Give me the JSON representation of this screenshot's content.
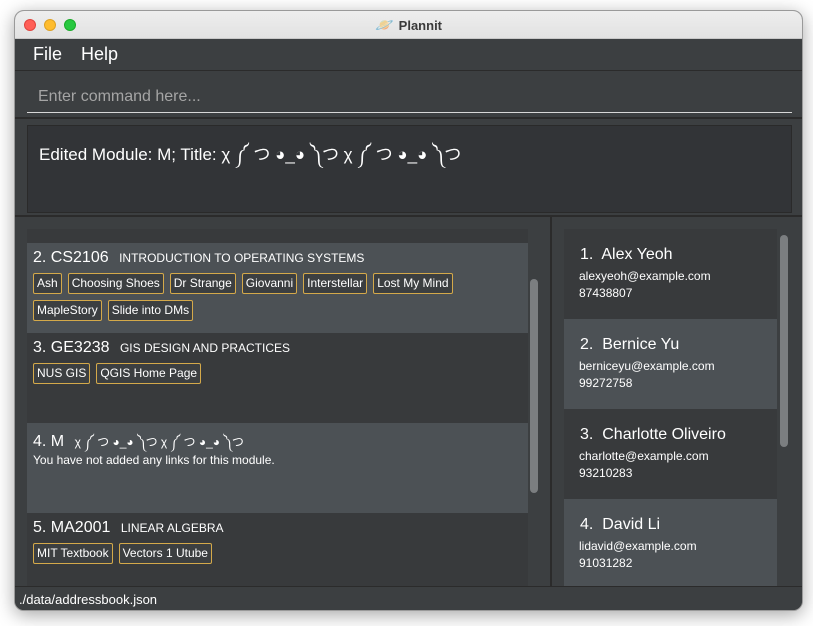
{
  "window": {
    "title": "Plannit",
    "app_icon": "planet-icon"
  },
  "menu": {
    "file_label": "File",
    "help_label": "Help"
  },
  "command": {
    "placeholder": "Enter command here...",
    "value": ""
  },
  "result": {
    "text": "Edited Module: M; Title: χ ༼ つ ◕_◕ ༽つ χ ༼ つ ◕_◕ ༽つ"
  },
  "modules": [
    {
      "number": "2.",
      "code": "CS2106",
      "title": "INTRODUCTION TO OPERATING SYSTEMS",
      "links": [
        "Ash",
        "Choosing Shoes",
        "Dr Strange",
        "Giovanni",
        "Interstellar",
        "Lost My Mind",
        "MapleStory",
        "Slide into DMs"
      ]
    },
    {
      "number": "3.",
      "code": "GE3238",
      "title": "GIS DESIGN AND PRACTICES",
      "links": [
        "NUS GIS",
        "QGIS Home Page"
      ]
    },
    {
      "number": "4.",
      "code": "M",
      "title": "χ ༼ つ ◕_◕ ༽つ χ ༼ つ ◕_◕ ༽つ",
      "empty_message": "You have not added any links for this module.",
      "links": []
    },
    {
      "number": "5.",
      "code": "MA2001",
      "title": "LINEAR ALGEBRA",
      "links": [
        "MIT Textbook",
        "Vectors 1 Utube"
      ]
    }
  ],
  "persons": [
    {
      "number": "1.",
      "name": "Alex Yeoh",
      "email": "alexyeoh@example.com",
      "phone": "87438807"
    },
    {
      "number": "2.",
      "name": "Bernice Yu",
      "email": "berniceyu@example.com",
      "phone": "99272758"
    },
    {
      "number": "3.",
      "name": "Charlotte Oliveiro",
      "email": "charlotte@example.com",
      "phone": "93210283"
    },
    {
      "number": "4.",
      "name": "David Li",
      "email": "lidavid@example.com",
      "phone": "91031282"
    }
  ],
  "status": {
    "path": "./data/addressbook.json"
  },
  "colors": {
    "accent_tag_border": "#d4a94a",
    "background": "#3c3f41",
    "card_light": "#4c5155",
    "card_dark": "#383a3c"
  }
}
